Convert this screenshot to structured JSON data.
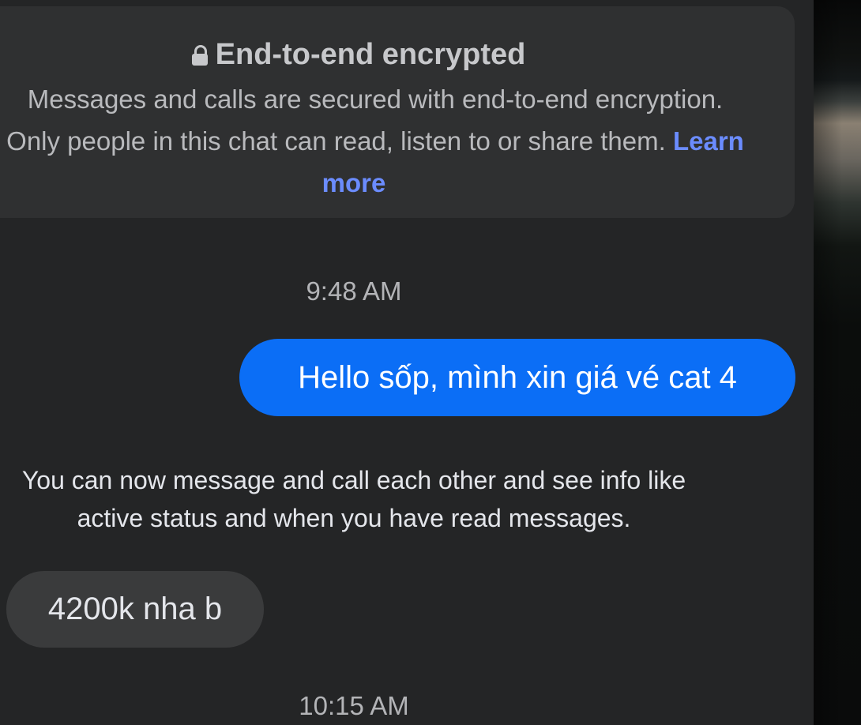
{
  "encryption_notice": {
    "title": "End-to-end encrypted",
    "line1": "Messages and calls are secured with end-to-end encryption.",
    "line2_text": "Only people in this chat can read, listen to or share them. ",
    "learn_more_part1": "Learn",
    "learn_more_part2": "more",
    "lock_icon": "lock-icon"
  },
  "conversation": {
    "timestamp_1": "9:48 AM",
    "outgoing_message": "Hello sốp, mình xin giá vé cat 4",
    "system_message_line1": "You can now message and call each other and see info like",
    "system_message_line2": "active status and when you have read messages.",
    "incoming_message": "4200k nha b",
    "timestamp_2": "10:15 AM"
  },
  "colors": {
    "background": "#242526",
    "notice_card": "#2f3031",
    "outgoing_bubble": "#0b6ef6",
    "incoming_bubble": "#3a3b3c",
    "link": "#6b8cff"
  }
}
